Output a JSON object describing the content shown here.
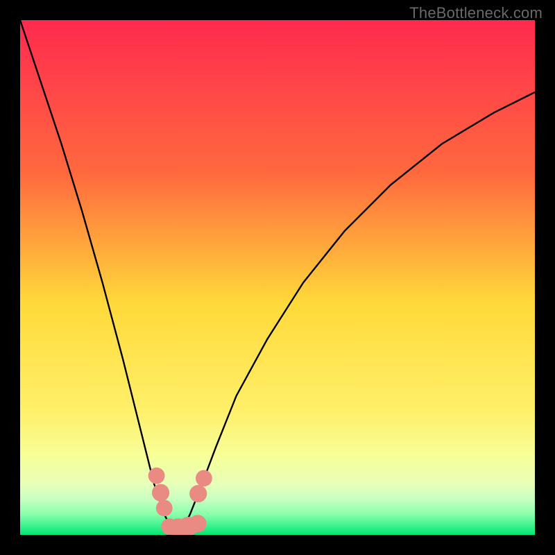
{
  "watermark": "TheBottleneck.com",
  "chart_data": {
    "type": "line",
    "title": "",
    "xlabel": "",
    "ylabel": "",
    "xlim": [
      0,
      100
    ],
    "ylim": [
      0,
      100
    ],
    "gradient_colors": {
      "top": "#ff2a4f",
      "upper_mid": "#ff8a3a",
      "mid": "#ffd93a",
      "lower_mid": "#f6ff8a",
      "band": "#d8ffb0",
      "bottom": "#00e676"
    },
    "series": [
      {
        "name": "bottleneck-curve",
        "x": [
          0,
          4,
          8,
          12,
          16,
          20,
          24,
          26,
          28,
          29,
          30,
          31,
          32,
          33,
          35,
          38,
          42,
          48,
          55,
          63,
          72,
          82,
          92,
          100
        ],
        "y": [
          100,
          88,
          76,
          63,
          49,
          34,
          18,
          10,
          4,
          2,
          1.2,
          1.2,
          2,
          4,
          9,
          17,
          27,
          38,
          49,
          59,
          68,
          76,
          82,
          86
        ]
      }
    ],
    "markers": [
      {
        "name": "left-cluster-1",
        "x": 26.5,
        "y": 11.5,
        "r": 1.6
      },
      {
        "name": "left-cluster-2",
        "x": 27.3,
        "y": 8.2,
        "r": 1.7
      },
      {
        "name": "left-cluster-3",
        "x": 28.0,
        "y": 5.2,
        "r": 1.6
      },
      {
        "name": "bottom-1",
        "x": 29.0,
        "y": 1.6,
        "r": 1.6
      },
      {
        "name": "bottom-2",
        "x": 30.7,
        "y": 1.3,
        "r": 1.9
      },
      {
        "name": "bottom-3",
        "x": 32.6,
        "y": 1.6,
        "r": 1.9
      },
      {
        "name": "bottom-4",
        "x": 34.5,
        "y": 2.2,
        "r": 1.7
      },
      {
        "name": "right-cluster-1",
        "x": 34.6,
        "y": 8.0,
        "r": 1.7
      },
      {
        "name": "right-cluster-2",
        "x": 35.7,
        "y": 11.0,
        "r": 1.6
      }
    ],
    "marker_color": "#e98b82"
  }
}
